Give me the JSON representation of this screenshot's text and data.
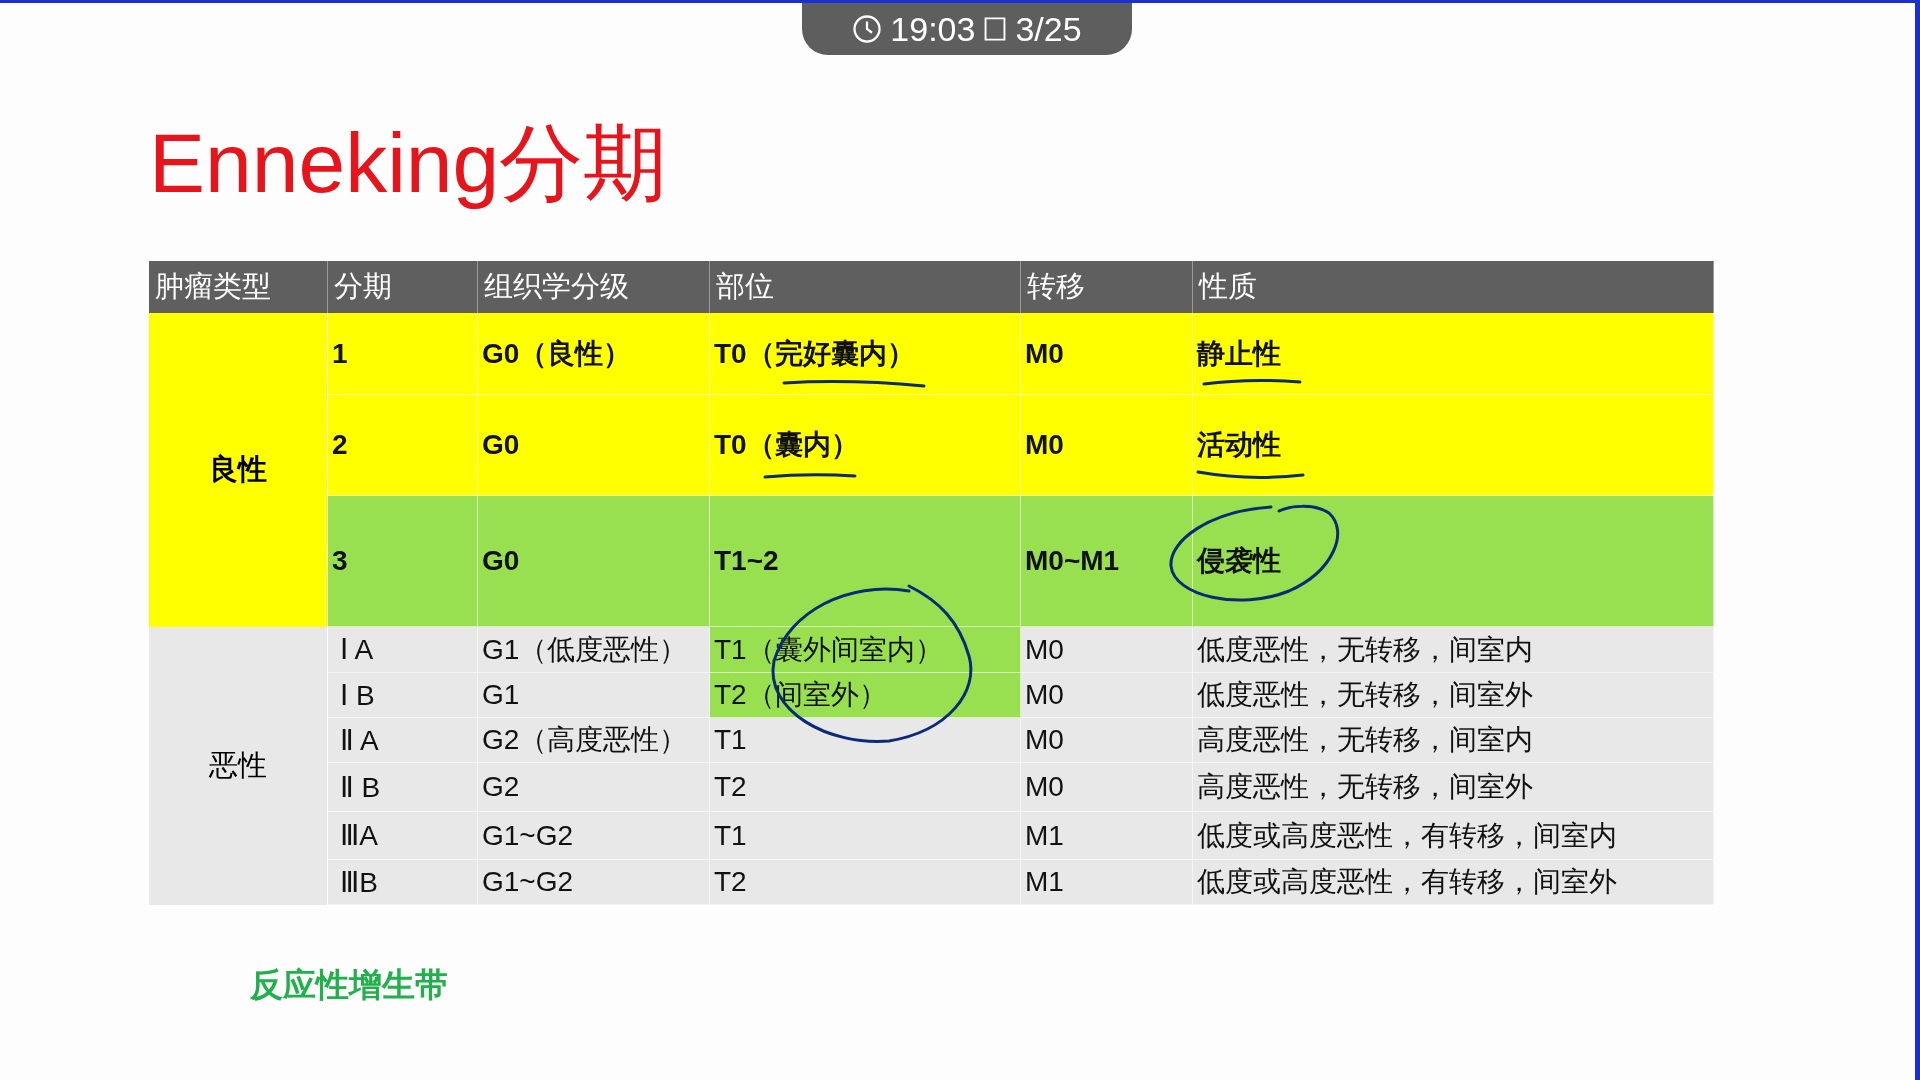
{
  "top_bar": {
    "time": "19:03",
    "page": "3/25"
  },
  "title": "Enneking分期",
  "table": {
    "columns": [
      "肿瘤类型",
      "分期",
      "组织学分级",
      "部位",
      "转移",
      "性质"
    ],
    "groups": [
      {
        "type": "良性",
        "kind": "benign",
        "color": "#ffff00",
        "rows": [
          {
            "stage": "1",
            "grade": "G0（良性）",
            "site": "T0（完好囊内）",
            "metastasis": "M0",
            "nature": "静止性",
            "color": "#ffff00"
          },
          {
            "stage": "2",
            "grade": "G0",
            "site": "T0（囊内）",
            "metastasis": "M0",
            "nature": "活动性",
            "color": "#ffff00"
          },
          {
            "stage": "3",
            "grade": "G0",
            "site": "T1~2",
            "metastasis": "M0~M1",
            "nature": "侵袭性",
            "color": "#99e050"
          }
        ]
      },
      {
        "type": "恶性",
        "kind": "malignant",
        "color": "#e8e8e8",
        "rows": [
          {
            "stage": "Ⅰ A",
            "grade": "G1（低度恶性）",
            "site": "T1（囊外间室内）",
            "metastasis": "M0",
            "nature": "低度恶性，无转移，间室内",
            "color": "#e8e8e8",
            "site_highlight": true
          },
          {
            "stage": "Ⅰ B",
            "grade": "G1",
            "site": "T2（间室外）",
            "metastasis": "M0",
            "nature": "低度恶性，无转移，间室外",
            "color": "#e8e8e8",
            "site_highlight": true
          },
          {
            "stage": "Ⅱ A",
            "grade": "G2（高度恶性）",
            "site": "T1",
            "metastasis": "M0",
            "nature": "高度恶性，无转移，间室内",
            "color": "#e8e8e8",
            "site_highlight": false
          },
          {
            "stage": "Ⅱ B",
            "grade": "G2",
            "site": "T2",
            "metastasis": "M0",
            "nature": "高度恶性，无转移，间室外",
            "color": "#e8e8e8",
            "site_highlight": false
          },
          {
            "stage": "ⅢA",
            "grade": "G1~G2",
            "site": "T1",
            "metastasis": "M1",
            "nature": "低度或高度恶性，有转移，间室内",
            "color": "#e8e8e8",
            "site_highlight": false
          },
          {
            "stage": "ⅢB",
            "grade": "G1~G2",
            "site": "T2",
            "metastasis": "M1",
            "nature": "低度或高度恶性，有转移，间室外",
            "color": "#e8e8e8",
            "site_highlight": false
          }
        ]
      }
    ]
  },
  "footnote": "反应性增生带"
}
